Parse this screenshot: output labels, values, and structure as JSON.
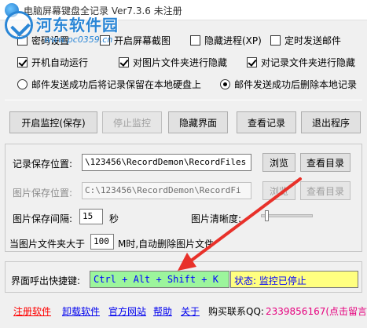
{
  "title": {
    "text": "电脑屏幕键盘全记录  Ver7.3.6  未注册"
  },
  "watermark": {
    "text": "河东软件园",
    "url": "www.pc0359.cn"
  },
  "options": {
    "row1": [
      {
        "label": "密码设置",
        "checked": false
      },
      {
        "label": "开启屏幕截图",
        "checked": false
      },
      {
        "label": "隐藏进程(XP)",
        "checked": false
      },
      {
        "label": "定时发送邮件",
        "checked": false
      }
    ],
    "row2": [
      {
        "label": "开机自动运行",
        "checked": true
      },
      {
        "label": "对图片文件夹进行隐藏",
        "checked": true
      },
      {
        "label": "对记录文件夹进行隐藏",
        "checked": true
      }
    ],
    "row3": [
      {
        "label": "邮件发送成功后将记录保留在本地硬盘上",
        "selected": false
      },
      {
        "label": "邮件发送成功后删除本地记录",
        "selected": true
      }
    ]
  },
  "buttons": {
    "start": "开启监控(保存)",
    "stop": "停止监控",
    "hide": "隐藏界面",
    "view": "查看记录",
    "exit": "退出程序"
  },
  "record": {
    "label": "记录保存位置:",
    "path": "\\123456\\RecordDemon\\RecordFiles",
    "browse": "浏览",
    "view_dir": "查看目录"
  },
  "image": {
    "label": "图片保存位置:",
    "path": "C:\\123456\\RecordDemon\\RecordFi",
    "browse": "浏览",
    "view_dir": "查看目录",
    "interval_label": "图片保存间隔:",
    "interval_value": "15",
    "interval_unit": "秒",
    "clarity_label": "图片清晰度:",
    "clarity_level": 0.08,
    "folder_prefix": "当图片文件夹大于",
    "folder_value": "100",
    "folder_suffix": "M时,自动删除图片文件"
  },
  "hotkey": {
    "label": "界面呼出快捷键:",
    "value": "Ctrl + Alt + Shift + K",
    "status": "状态: 监控已停止"
  },
  "footer": {
    "links": [
      "注册软件",
      "卸载软件",
      "官方网站",
      "帮助",
      "关于"
    ],
    "qq_label": "购买联系QQ:",
    "qq_value": "2339856167(点击留言)"
  },
  "colors": {
    "hotkey_bg": "#9cf59c",
    "status_bg": "#ffff80",
    "link_blue": "#0000ee",
    "link_red": "#ff0000",
    "qq_pink": "#e6007e",
    "arrow_red": "#e8312a"
  }
}
